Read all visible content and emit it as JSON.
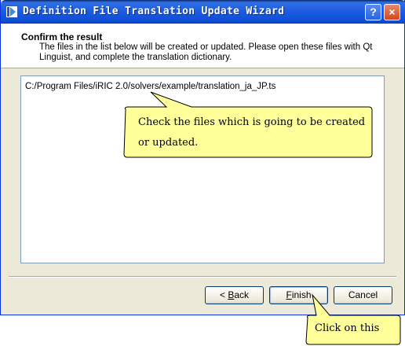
{
  "window": {
    "title": "Definition File Translation Update Wizard",
    "help_label": "?",
    "close_label": "×"
  },
  "header": {
    "title": "Confirm the result",
    "description": "The files in the list below will be created or updated. Please open these files with Qt Linguist, and complete the translation dictionary."
  },
  "file_list": {
    "items": [
      "C:/Program Files/iRIC 2.0/solvers/example/translation_ja_JP.ts"
    ]
  },
  "buttons": {
    "back_prefix": "< ",
    "back_key": "B",
    "back_rest": "ack",
    "finish_key": "F",
    "finish_rest": "inish",
    "cancel": "Cancel"
  },
  "callouts": {
    "files_line1": "Check the files which is going to be created",
    "files_line2": "or updated.",
    "finish_hint": "Click on this"
  },
  "colors": {
    "titlebar": "#1c5be0",
    "callout_fill": "#ffff99",
    "window_bg": "#ece9d8"
  }
}
